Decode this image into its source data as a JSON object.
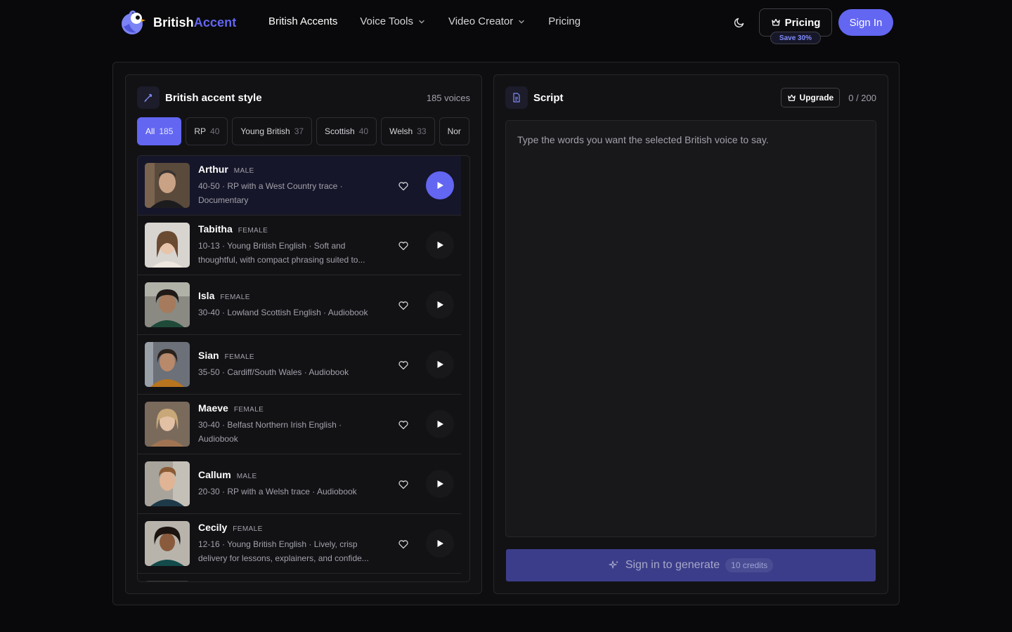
{
  "brand": {
    "name_part1": "British",
    "name_part2": "Accent",
    "accent_color": "#6366f1"
  },
  "nav": {
    "items": [
      {
        "label": "British Accents",
        "has_dropdown": false,
        "active": true
      },
      {
        "label": "Voice Tools",
        "has_dropdown": true,
        "active": false
      },
      {
        "label": "Video Creator",
        "has_dropdown": true,
        "active": false
      },
      {
        "label": "Pricing",
        "has_dropdown": false,
        "active": false
      }
    ]
  },
  "header_actions": {
    "theme_icon": "moon-icon",
    "pricing_label": "Pricing",
    "pricing_icon": "crown-icon",
    "save_badge": "Save 30%",
    "signin_label": "Sign In"
  },
  "accent_panel": {
    "title": "British accent style",
    "icon": "pen-icon",
    "voice_count": "185 voices",
    "filters": [
      {
        "label": "All",
        "count": "185",
        "active": true
      },
      {
        "label": "RP",
        "count": "40",
        "active": false
      },
      {
        "label": "Young British",
        "count": "37",
        "active": false
      },
      {
        "label": "Scottish",
        "count": "40",
        "active": false
      },
      {
        "label": "Welsh",
        "count": "33",
        "active": false
      },
      {
        "label": "Nor",
        "count": "",
        "active": false
      }
    ],
    "voices": [
      {
        "name": "Arthur",
        "gender": "MALE",
        "description": "40-50 · RP with a West Country trace · Documentary",
        "selected": true
      },
      {
        "name": "Tabitha",
        "gender": "FEMALE",
        "description": "10-13 · Young British English · Soft and thoughtful, with compact phrasing suited to...",
        "selected": false
      },
      {
        "name": "Isla",
        "gender": "FEMALE",
        "description": "30-40 · Lowland Scottish English · Audiobook",
        "selected": false
      },
      {
        "name": "Sian",
        "gender": "FEMALE",
        "description": "35-50 · Cardiff/South Wales · Audiobook",
        "selected": false
      },
      {
        "name": "Maeve",
        "gender": "FEMALE",
        "description": "30-40 · Belfast Northern Irish English · Audiobook",
        "selected": false
      },
      {
        "name": "Callum",
        "gender": "MALE",
        "description": "20-30 · RP with a Welsh trace · Audiobook",
        "selected": false
      },
      {
        "name": "Cecily",
        "gender": "FEMALE",
        "description": "12-16 · Young British English · Lively, crisp delivery for lessons, explainers, and confide...",
        "selected": false
      }
    ]
  },
  "script_panel": {
    "title": "Script",
    "icon": "document-icon",
    "upgrade_label": "Upgrade",
    "char_count": "0 / 200",
    "placeholder": "Type the words you want the selected British voice to say.",
    "generate_label": "Sign in to generate",
    "generate_icon": "sparkle-icon",
    "credits_label": "10 credits"
  }
}
